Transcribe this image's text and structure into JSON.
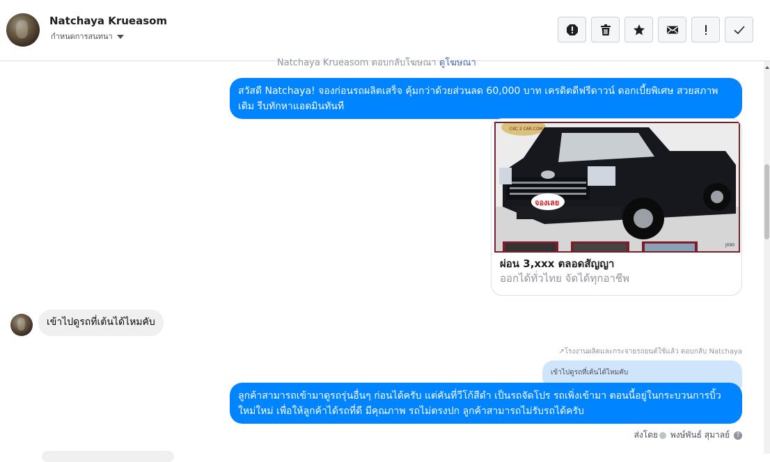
{
  "header": {
    "name": "Natchaya Krueasom",
    "subtitle": "กำหนดการสนทนา",
    "actions": [
      "spam-icon",
      "trash-icon",
      "star-icon",
      "mail-icon",
      "exclaim-icon",
      "check-icon"
    ]
  },
  "conversation": {
    "faded_top_prefix": "Natchaya Krueasom ตอบกลับโฆษณา",
    "faded_top_link": "ดูโฆษณา",
    "outgoing_1": "สวัสดี Natchaya! จองก่อนรถผลิตเสร็จ คุ้มกว่าด้วยส่วนลด 60,000 บาท เครดิตดีฟรีดาวน์ ดอกเบี้ยพิเศษ สวยสภาพเดิม รีบทักหาแอดมินทันที",
    "card": {
      "image_logo": "CKC 2 CAR.COM",
      "image_badge": "จองเลย",
      "image_code": "J090",
      "title": "ผ่อน 3,xxx ตลอดสัญญา",
      "subtitle": "ออกได้ทั่วไทย จัดได้ทุกอาชีพ"
    },
    "incoming_1": "เข้าไปดูรถที่เต้นได้ไหมคับ",
    "reply_note": "↗โรงงานผลิตและกระจายรถยนต์ใช้แล้ว ตอบกลับ Natchaya",
    "quoted": "เข้าไปดูรถที่เต้นได้ไหมคับ",
    "outgoing_2": "ลูกค้าสามารถเข้ามาดูรถรุ่นอื่นๆ ก่อนได้ครับ แต่คันที่วีโก้สีดำ เป็นรถจัดโปร รถเพิ่งเข้ามา ตอนนี้อยู่ในกระบวนการบิ้วใหม่ใหม่ เพื่อให้ลูกค้าได้รถที่ดี มีคุณภาพ รถไม่ตรงปก ลูกค้าสามารถไม่รับรถได้ครับ",
    "sent_by_label": "ส่งโดย",
    "sent_by_name": "พงษ์พันธ์ สุมาลย์"
  },
  "colors": {
    "outgoing": "#0084ff",
    "incoming": "#f1f0f0",
    "quoted": "#cfe5fc"
  }
}
